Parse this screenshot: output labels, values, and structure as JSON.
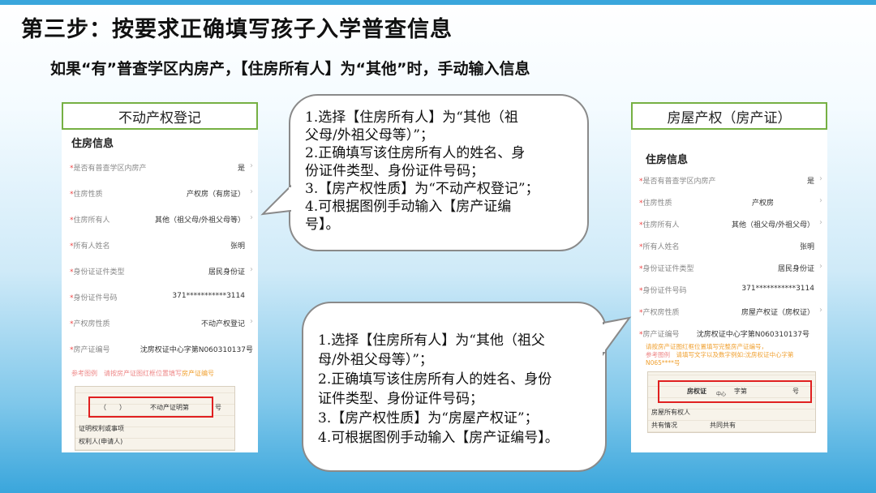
{
  "title": "第三步：按要求正确填写孩子入学普查信息",
  "subtitle": "如果“有”普查学区内房产，【住房所有人】为“其他”时，手动输入信息",
  "left_panel": {
    "label": "不动产权登记",
    "section_title": "住房信息",
    "rows": [
      {
        "key": "是否有普查学区内房产",
        "value": "是"
      },
      {
        "key": "住房性质",
        "value": "产权房（有房证）"
      },
      {
        "key": "住房所有人",
        "value": "其他（祖父母/外祖父母等）"
      },
      {
        "key": "所有人姓名",
        "value": "张明"
      },
      {
        "key": "身份证证件类型",
        "value": "居民身份证"
      },
      {
        "key": "身份证件号码",
        "value": "371***********3114"
      },
      {
        "key": "产权房性质",
        "value": "不动产权登记"
      },
      {
        "key": "房产证编号",
        "value": "沈房权证中心字第N060310137号"
      }
    ],
    "ref_label": "参考图例",
    "ref_hint": "请按房产证图红框位置填写",
    "ref_hint_hl": "房产证编号",
    "doc_texts": [
      "（　　）",
      "不动产证明第",
      "号",
      "证明权利或事项",
      "权利人(申请人)"
    ]
  },
  "right_panel": {
    "label": "房屋产权（房产证）",
    "section_title": "住房信息",
    "rows": [
      {
        "key": "是否有普查学区内房产",
        "value": "是"
      },
      {
        "key": "住房性质",
        "value": "产权房"
      },
      {
        "key": "住房所有人",
        "value": "其他（祖父母/外祖父母）"
      },
      {
        "key": "所有人姓名",
        "value": "张明"
      },
      {
        "key": "身份证证件类型",
        "value": "居民身份证"
      },
      {
        "key": "身份证件号码",
        "value": "371***********3114"
      },
      {
        "key": "产权房性质",
        "value": "房屋产权证（房权证）"
      },
      {
        "key": "房产证编号",
        "value": "沈房权证中心字第N060310137号"
      }
    ],
    "ref_label": "参考图例",
    "ref_hint_lines": [
      "请按房产证图红框位置填写完整房产证编号，",
      "请填写文字以及数字例如:沈房权证中心字第",
      "N065****号"
    ],
    "doc_texts": [
      "房权证",
      "中心",
      "字第",
      "号",
      "房屋所有权人",
      "共有情况",
      "共同共有"
    ]
  },
  "bubble_top": {
    "lines": [
      "1.选择【住房所有人】为“其他（祖",
      "父母/外祖父母等）”；",
      "2.正确填写该住房所有人的姓名、身",
      "份证件类型、身份证件号码；",
      "3.【房产权性质】为“不动产权登记”；",
      "4.可根据图例手动输入【房产证编",
      "号】。"
    ]
  },
  "bubble_bottom": {
    "lines": [
      "1.选择【住房所有人】为“其他（祖父",
      "母/外祖父母等）”；",
      "2.正确填写该住房所有人的姓名、身份",
      "证件类型、身份证件号码；",
      "3.【房产权性质】为“房屋产权证”；",
      "4.可根据图例手动输入【房产证编号】。"
    ]
  },
  "colors": {
    "accent_blue": "#3aa6dc",
    "label_border": "#76b043",
    "red_box": "#e02020"
  }
}
